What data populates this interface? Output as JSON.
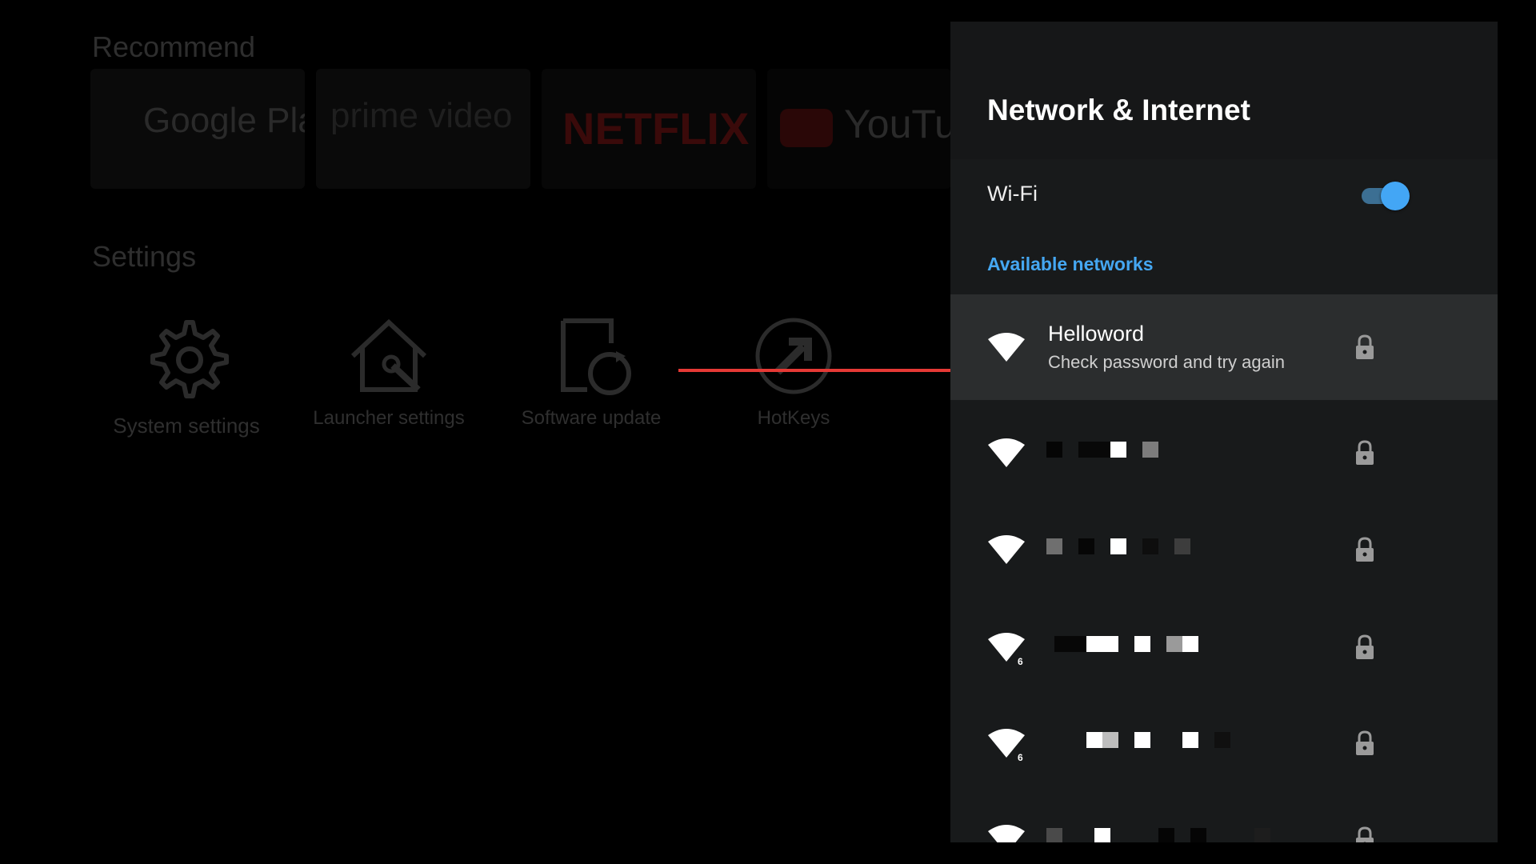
{
  "background": {
    "recommend_title": "Recommend",
    "apps": [
      {
        "label": "Google Play",
        "color": "#2a2a2a"
      },
      {
        "label": "prime video",
        "color": "#1e1e1e"
      },
      {
        "label": "NETFLIX",
        "color": "#3a0a0a"
      },
      {
        "label": "YouTube",
        "color": "#2a2a2a"
      }
    ],
    "settings_title": "Settings",
    "settings_items": [
      {
        "label": "System settings",
        "icon": "gear-icon"
      },
      {
        "label": "Launcher settings",
        "icon": "home-wrench-icon"
      },
      {
        "label": "Software update",
        "icon": "update-icon"
      },
      {
        "label": "HotKeys",
        "icon": "shortcut-arrow-icon"
      }
    ]
  },
  "panel": {
    "title": "Network & Internet",
    "wifi_label": "Wi-Fi",
    "wifi_enabled": true,
    "available_header": "Available networks",
    "networks": [
      {
        "name": "Helloword",
        "status": "Check password and try again",
        "secured": true,
        "focused": true,
        "wifi6": false
      },
      {
        "name": "",
        "redacted": true,
        "secured": true,
        "wifi6": false
      },
      {
        "name": "",
        "redacted": true,
        "secured": true,
        "wifi6": false
      },
      {
        "name": "",
        "redacted": true,
        "secured": true,
        "wifi6": true
      },
      {
        "name": "",
        "redacted": true,
        "secured": true,
        "wifi6": true
      },
      {
        "name": "",
        "redacted": true,
        "secured": true,
        "wifi6": false
      }
    ]
  },
  "colors": {
    "accent": "#45a7f2",
    "panel_bg": "#181a1b",
    "focused_row": "#2b2d2e",
    "arrow": "#e53935"
  }
}
